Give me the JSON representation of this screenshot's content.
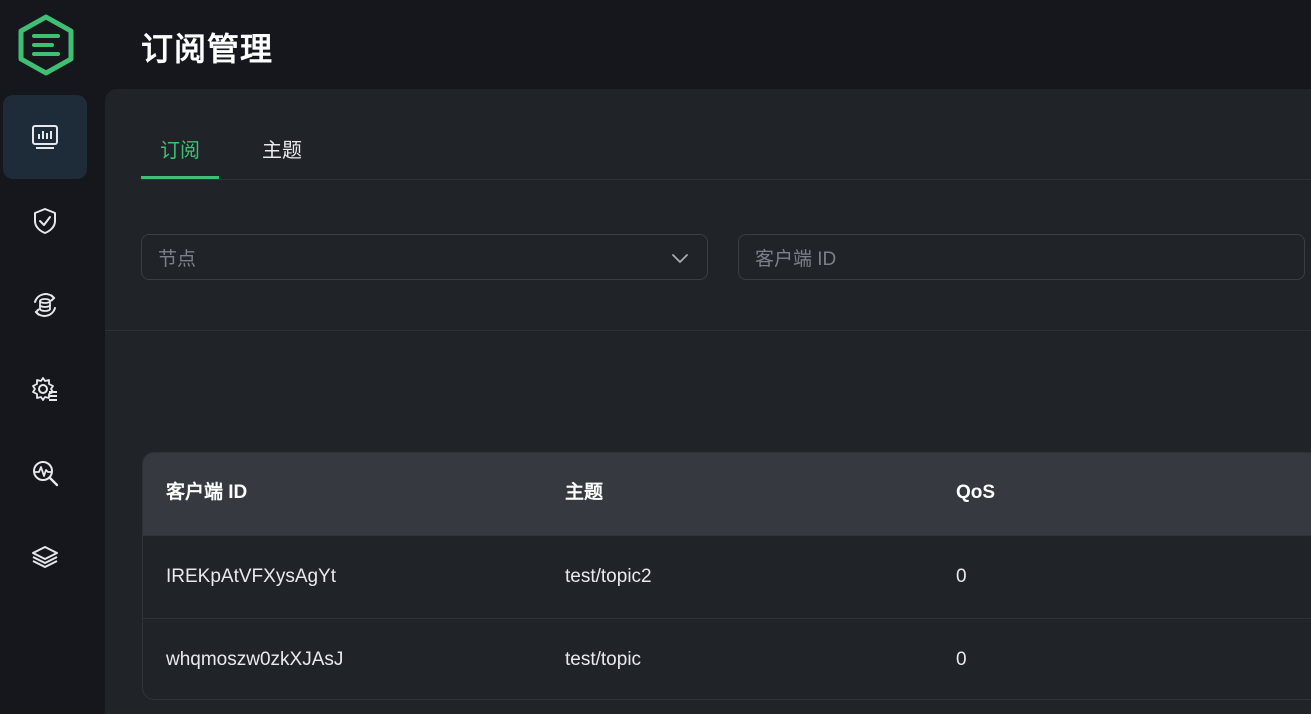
{
  "header": {
    "title": "订阅管理"
  },
  "sidebar": {
    "items": [
      {
        "icon": "monitor-chart-icon",
        "active": true
      },
      {
        "icon": "shield-check-icon",
        "active": false
      },
      {
        "icon": "data-sync-icon",
        "active": false
      },
      {
        "icon": "gear-list-icon",
        "active": false
      },
      {
        "icon": "diagnose-search-icon",
        "active": false
      },
      {
        "icon": "layers-icon",
        "active": false
      }
    ]
  },
  "tabs": [
    {
      "label": "订阅",
      "active": true
    },
    {
      "label": "主题",
      "active": false
    }
  ],
  "filters": {
    "node": {
      "placeholder": "节点"
    },
    "client_id": {
      "placeholder": "客户端 ID"
    }
  },
  "table": {
    "columns": [
      "客户端 ID",
      "主题",
      "QoS"
    ],
    "rows": [
      {
        "client_id": "IREKpAtVFXysAgYt",
        "topic": "test/topic2",
        "qos": "0"
      },
      {
        "client_id": "whqmoszw0zkXJAsJ",
        "topic": "test/topic",
        "qos": "0"
      }
    ]
  },
  "colors": {
    "accent": "#3fbf74",
    "active_nav_bg": "#1e2b38"
  }
}
